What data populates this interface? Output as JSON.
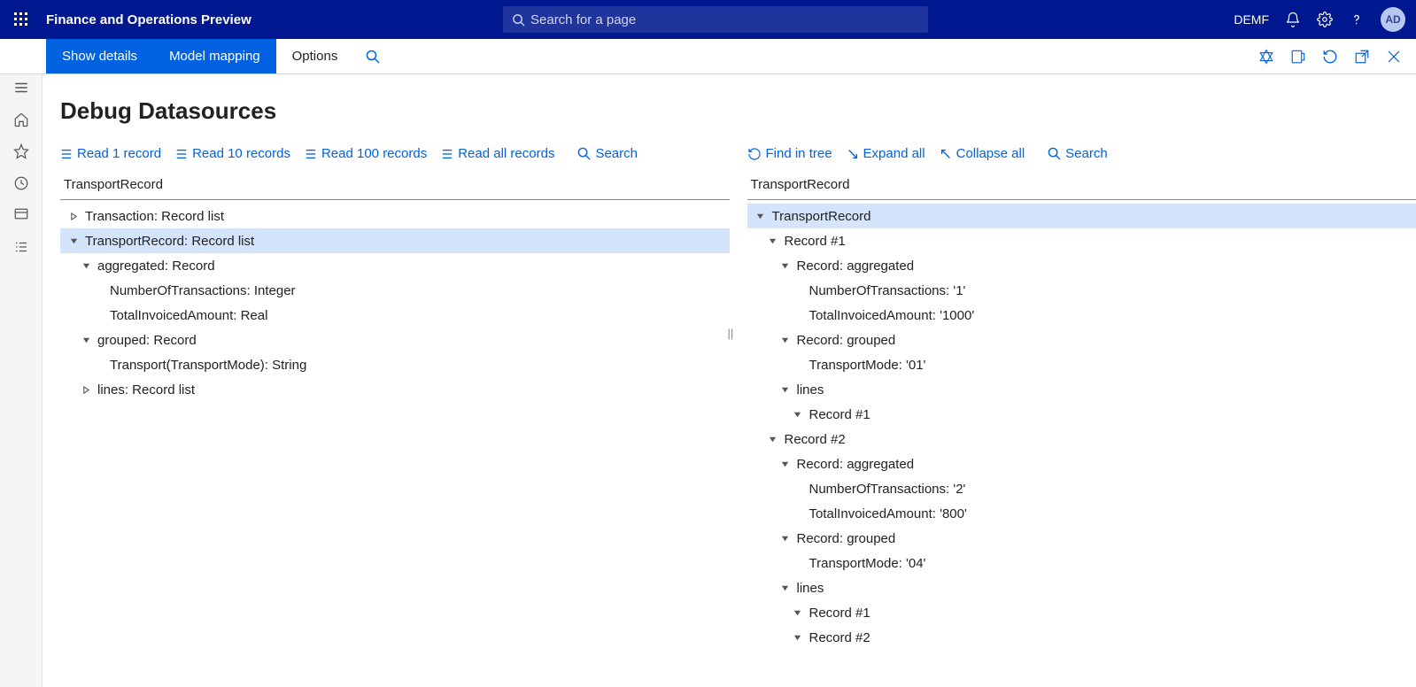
{
  "header": {
    "app_title": "Finance and Operations Preview",
    "search_placeholder": "Search for a page",
    "company": "DEMF",
    "user_initials": "AD"
  },
  "ribbon": {
    "show_details": "Show details",
    "model_mapping": "Model mapping",
    "options": "Options"
  },
  "page": {
    "title": "Debug Datasources"
  },
  "left_toolbar": {
    "read1": "Read 1 record",
    "read10": "Read 10 records",
    "read100": "Read 100 records",
    "readall": "Read all records",
    "search": "Search"
  },
  "right_toolbar": {
    "find": "Find in tree",
    "expand": "Expand all",
    "collapse": "Collapse all",
    "search": "Search"
  },
  "left_pane": {
    "title": "TransportRecord",
    "rows": [
      {
        "indent": 0,
        "chev": "right",
        "label": "Transaction: Record list"
      },
      {
        "indent": 0,
        "chev": "down",
        "label": "TransportRecord: Record list",
        "selected": true
      },
      {
        "indent": 1,
        "chev": "down",
        "label": "aggregated: Record"
      },
      {
        "indent": 2,
        "chev": "",
        "label": "NumberOfTransactions: Integer"
      },
      {
        "indent": 2,
        "chev": "",
        "label": "TotalInvoicedAmount: Real"
      },
      {
        "indent": 1,
        "chev": "down",
        "label": "grouped: Record"
      },
      {
        "indent": 2,
        "chev": "",
        "label": "Transport(TransportMode): String"
      },
      {
        "indent": 1,
        "chev": "right",
        "label": "lines: Record list"
      }
    ]
  },
  "right_pane": {
    "title": "TransportRecord",
    "rows": [
      {
        "indent": 0,
        "chev": "down",
        "label": "TransportRecord",
        "selected": true
      },
      {
        "indent": 1,
        "chev": "down",
        "label": "Record #1"
      },
      {
        "indent": 2,
        "chev": "down",
        "label": "Record: aggregated"
      },
      {
        "indent": 3,
        "chev": "",
        "label": "NumberOfTransactions: '1'"
      },
      {
        "indent": 3,
        "chev": "",
        "label": "TotalInvoicedAmount: '1000'"
      },
      {
        "indent": 2,
        "chev": "down",
        "label": "Record: grouped"
      },
      {
        "indent": 3,
        "chev": "",
        "label": "TransportMode: '01'"
      },
      {
        "indent": 2,
        "chev": "down",
        "label": "lines"
      },
      {
        "indent": 3,
        "chev": "down",
        "label": "Record #1"
      },
      {
        "indent": 1,
        "chev": "down",
        "label": "Record #2"
      },
      {
        "indent": 2,
        "chev": "down",
        "label": "Record: aggregated"
      },
      {
        "indent": 3,
        "chev": "",
        "label": "NumberOfTransactions: '2'"
      },
      {
        "indent": 3,
        "chev": "",
        "label": "TotalInvoicedAmount: '800'"
      },
      {
        "indent": 2,
        "chev": "down",
        "label": "Record: grouped"
      },
      {
        "indent": 3,
        "chev": "",
        "label": "TransportMode: '04'"
      },
      {
        "indent": 2,
        "chev": "down",
        "label": "lines"
      },
      {
        "indent": 3,
        "chev": "down",
        "label": "Record #1"
      },
      {
        "indent": 3,
        "chev": "down",
        "label": "Record #2"
      }
    ]
  }
}
